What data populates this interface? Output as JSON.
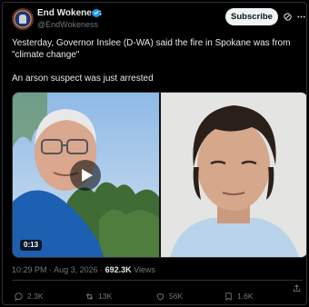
{
  "author": {
    "display_name": "End Wokeness",
    "handle": "@EndWokeness"
  },
  "header": {
    "subscribe_label": "Subscribe"
  },
  "tweet": {
    "line1": "Yesterday, Governor Inslee (D-WA) said the fire in Spokane was from \"climate change\"",
    "line2": "An arson suspect was just arrested"
  },
  "media": {
    "video_duration": "0:13"
  },
  "meta": {
    "time": "10:29 PM",
    "date": "Aug 3, 2026",
    "separator": "·",
    "views_count": "692.3K",
    "views_label": "Views"
  },
  "actions": {
    "replies": "2.3K",
    "reposts": "13K",
    "likes": "56K",
    "bookmarks": "1.6K"
  },
  "colors": {
    "background": "#000000",
    "text": "#e7e9ea",
    "muted": "#71767b",
    "border": "#2f3336",
    "verified": "#1d9bf0",
    "subscribe_bg": "#eff3f4"
  },
  "icons": {
    "verified": "verified-badge-icon",
    "grok": "grok-icon",
    "more": "more-icon",
    "play": "play-icon",
    "reply": "reply-icon",
    "repost": "repost-icon",
    "like": "heart-icon",
    "bookmark": "bookmark-icon",
    "share": "share-icon"
  }
}
